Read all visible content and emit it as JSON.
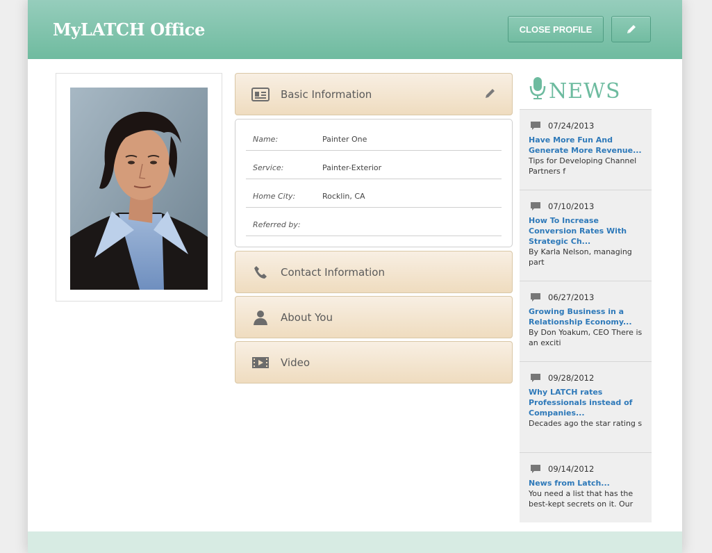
{
  "header": {
    "title": "MyLATCH Office",
    "close_profile_label": "CLOSE PROFILE",
    "edit_icon": "pencil-icon"
  },
  "profile": {
    "photo_alt": "Profile photo"
  },
  "sections": {
    "basic": {
      "label": "Basic Information",
      "icon": "id-card-icon"
    },
    "contact": {
      "label": "Contact Information",
      "icon": "phone-icon"
    },
    "about": {
      "label": "About You",
      "icon": "person-icon"
    },
    "video": {
      "label": "Video",
      "icon": "film-icon"
    }
  },
  "basic_info": [
    {
      "label": "Name:",
      "value": "Painter One"
    },
    {
      "label": "Service:",
      "value": "Painter-Exterior"
    },
    {
      "label": "Home City:",
      "value": "Rocklin, CA"
    },
    {
      "label": "Referred by:",
      "value": ""
    }
  ],
  "news": {
    "title": "NEWS",
    "items": [
      {
        "date": "07/24/2013",
        "title": "Have More Fun And Generate More Revenue...",
        "snippet": "Tips for Developing Channel Partners f"
      },
      {
        "date": "07/10/2013",
        "title": "How To Increase Conversion Rates With Strategic Ch...",
        "snippet": "By Karla Nelson, managing part"
      },
      {
        "date": "06/27/2013",
        "title": "Growing Business in a Relationship Economy...",
        "snippet": "By Don Yoakum, CEO There is an exciti"
      },
      {
        "date": "09/28/2012",
        "title": "Why LATCH rates Professionals instead of Companies...",
        "snippet": "Decades ago the star rating s"
      },
      {
        "date": "09/14/2012",
        "title": "News from Latch...",
        "snippet": "You need a list that has the best-kept secrets on it. Our"
      }
    ]
  },
  "colors": {
    "header": "#6fbb9f",
    "accent_link": "#2e79b9",
    "section_bg": "#f4e6d2"
  }
}
